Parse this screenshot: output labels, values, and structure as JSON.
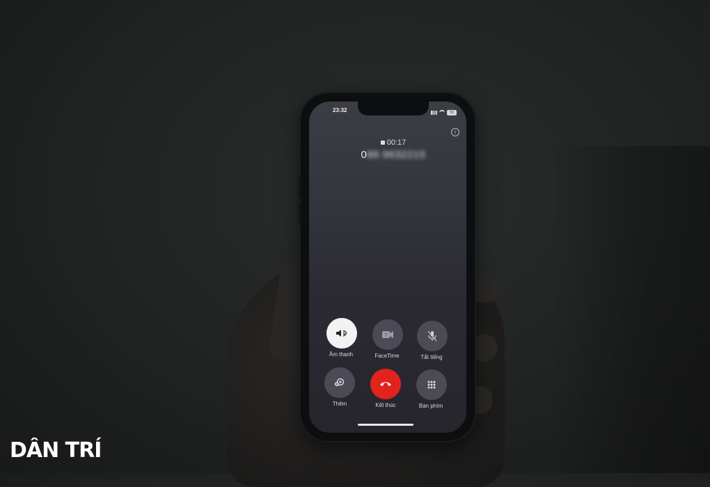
{
  "status_bar": {
    "time": "23:32",
    "battery": "53"
  },
  "call": {
    "timer": "00:17",
    "number": "0",
    "number_blurred": "86 9632215"
  },
  "controls": [
    {
      "label": "Âm thanh",
      "icon": "speaker-bluetooth-icon",
      "active": true
    },
    {
      "label": "FaceTime",
      "icon": "facetime-icon",
      "active": false
    },
    {
      "label": "Tắt tiếng",
      "icon": "mute-icon",
      "active": false
    },
    {
      "label": "Thêm",
      "icon": "add-call-icon",
      "active": false
    },
    {
      "label": "Kết thúc",
      "icon": "end-call-icon",
      "active": false
    },
    {
      "label": "Bàn phím",
      "icon": "keypad-icon",
      "active": false
    }
  ],
  "watermark": "DÂN TRÍ"
}
